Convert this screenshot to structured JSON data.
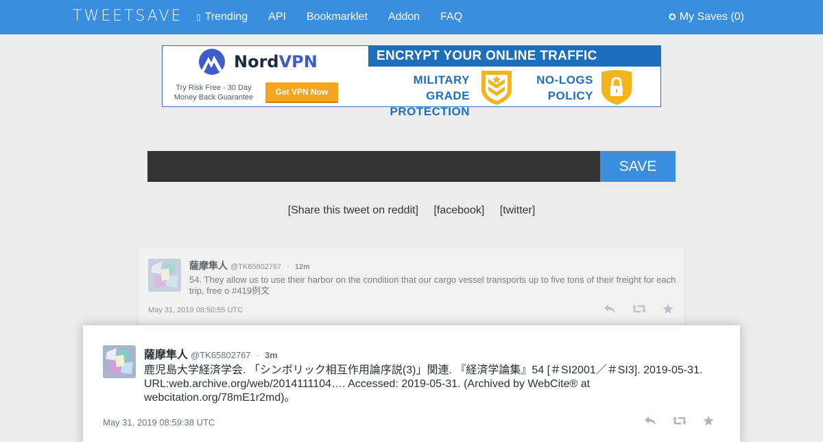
{
  "nav": {
    "logo": "TWEETSAVE",
    "items": [
      {
        "label": "Trending",
        "icon": "trending-icon"
      },
      {
        "label": "API"
      },
      {
        "label": "Bookmarklet"
      },
      {
        "label": "Addon"
      },
      {
        "label": "FAQ"
      }
    ],
    "my_saves": "My Saves (0)",
    "color": "#3a8ee0"
  },
  "ad": {
    "brand_a": "Nord",
    "brand_b": "VPN",
    "guarantee": "Try Risk Free - 30 Day Money Back Guarantee",
    "button": "Get VPN Now",
    "headline": "ENCRYPT YOUR ONLINE TRAFFIC",
    "feature1": "MILITARY GRADE PROTECTION",
    "feature2": "NO-LOGS POLICY"
  },
  "save": {
    "input_value": "",
    "button": "SAVE"
  },
  "share": {
    "reddit": "[Share this tweet on reddit]",
    "facebook": "[facebook]",
    "twitter": "[twitter]"
  },
  "tweets": [
    {
      "name": "薩摩隼人",
      "handle": "@TK65802767",
      "time": "12m",
      "text": "54. They allow us to use their harbor on the condition that our cargo vessel transports up to five tons of their freight for each trip, free o #419例文",
      "date": "May 31, 2019 08:50:55 UTC"
    },
    {
      "name": "薩摩隼人",
      "handle": "@TK65802767",
      "time": "3m",
      "text": "鹿児島大学経済学会. 「シンボリック相互作用論序説(3)」関連. 『経済学論集』54 [＃SI2001／＃SI3]. 2019-05-31. URL:web.archive.org/web/2014111104…. Accessed: 2019-05-31. (Archived by WebCite® at webcitation.org/78mE1r2md)。",
      "date": "May 31, 2019 08:59:38 UTC"
    }
  ]
}
